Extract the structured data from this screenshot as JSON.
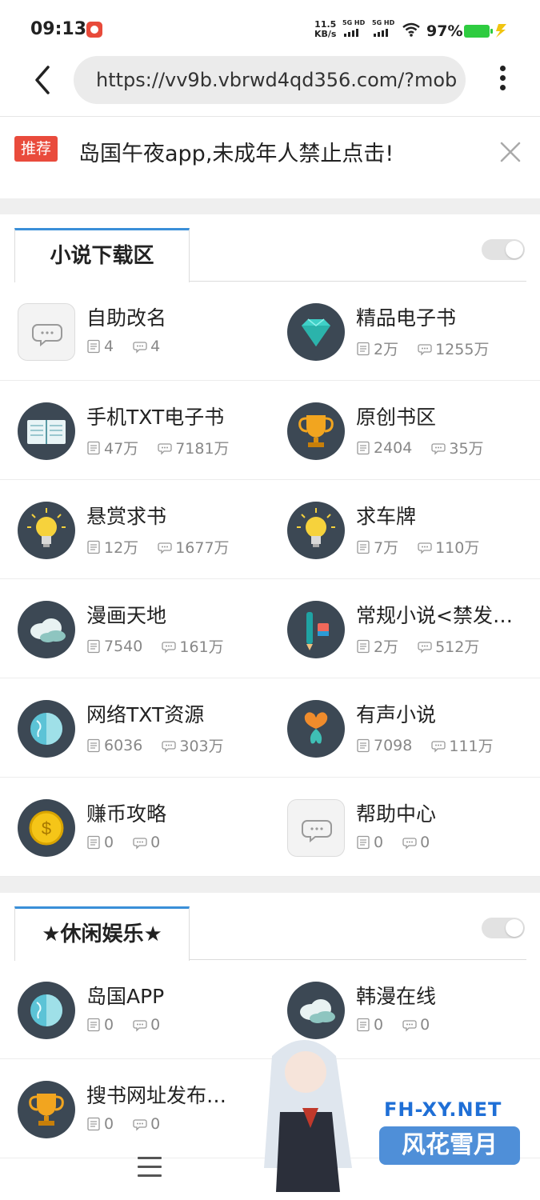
{
  "status": {
    "time": "09:13",
    "speed_top": "11.5",
    "speed_unit": "KB/s",
    "sig1_label": "5G HD",
    "sig2_label": "5G HD",
    "battery": "97%"
  },
  "browser": {
    "url": "https://vv9b.vbrwd4qd356.com/?mob"
  },
  "banner": {
    "tag": "推荐",
    "text": "岛国午夜app,未成年人禁止点击!"
  },
  "sections": [
    {
      "title": "小说下载区",
      "rows": [
        [
          {
            "name": "自助改名",
            "threads": "4",
            "posts": "4",
            "icon": "chat-bubble-icon"
          },
          {
            "name": "精品电子书",
            "threads": "2万",
            "posts": "1255万",
            "icon": "diamond-icon"
          }
        ],
        [
          {
            "name": "手机TXT电子书",
            "threads": "47万",
            "posts": "7181万",
            "icon": "book-icon"
          },
          {
            "name": "原创书区",
            "threads": "2404",
            "posts": "35万",
            "icon": "trophy-icon"
          }
        ],
        [
          {
            "name": "悬赏求书",
            "threads": "12万",
            "posts": "1677万",
            "icon": "lightbulb-icon"
          },
          {
            "name": "求车牌",
            "threads": "7万",
            "posts": "110万",
            "icon": "lightbulb-icon"
          }
        ],
        [
          {
            "name": "漫画天地",
            "threads": "7540",
            "posts": "161万",
            "icon": "cloud-icon"
          },
          {
            "name": "常规小说<禁发…",
            "threads": "2万",
            "posts": "512万",
            "icon": "pencil-icon"
          }
        ],
        [
          {
            "name": "网络TXT资源",
            "threads": "6036",
            "posts": "303万",
            "icon": "globe-icon"
          },
          {
            "name": "有声小说",
            "threads": "7098",
            "posts": "111万",
            "icon": "heart-icon"
          }
        ],
        [
          {
            "name": "赚币攻略",
            "threads": "0",
            "posts": "0",
            "icon": "coin-icon"
          },
          {
            "name": "帮助中心",
            "threads": "0",
            "posts": "0",
            "icon": "chat-bubble-icon"
          }
        ]
      ]
    },
    {
      "title": "★休闲娱乐★",
      "rows": [
        [
          {
            "name": "岛国APP",
            "threads": "0",
            "posts": "0",
            "icon": "globe-icon"
          },
          {
            "name": "韩漫在线",
            "threads": "0",
            "posts": "0",
            "icon": "cloud-icon"
          }
        ],
        [
          {
            "name": "搜书网址发布…",
            "threads": "0",
            "posts": "0",
            "icon": "trophy-icon"
          }
        ]
      ]
    }
  ],
  "watermark": {
    "url": "FH-XY.NET",
    "name": "风花雪月"
  },
  "colors": {
    "accent": "#3a8fd8",
    "tag_red": "#e94b3c",
    "battery_green": "#2ecc40",
    "icon_bg": "#3c4854"
  }
}
